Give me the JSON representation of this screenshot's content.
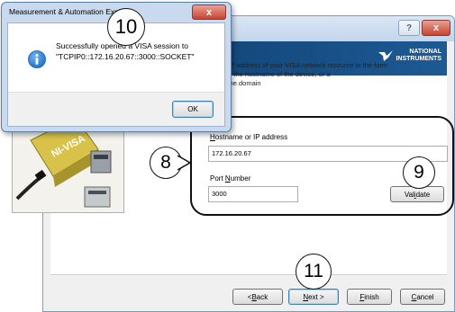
{
  "wizard": {
    "help_label": "?",
    "close_label": "x",
    "logo_line1": "NATIONAL",
    "logo_line2": "INSTRUMENTS",
    "instructions": [
      "Enter the TCP/IP address of your VISA network resource in the form",
      "xxx.xxx.xxx.xxx, the hostname of the device, or a",
      "hostname@some.domain"
    ],
    "hostname_label_accel": "H",
    "hostname_label_rest": "ostname or IP address",
    "hostname_value": "172.16.20.67",
    "port_label_pre": "Port ",
    "port_label_accel": "N",
    "port_label_rest": "umber",
    "port_value": "3000",
    "validate_pre": "Val",
    "validate_accel": "i",
    "validate_rest": "date",
    "back_pre": "< ",
    "back_accel": "B",
    "back_rest": "ack",
    "next_accel": "N",
    "next_rest": "ext >",
    "finish_accel": "F",
    "finish_rest": "inish",
    "cancel_accel": "C",
    "cancel_rest": "ancel"
  },
  "msgbox": {
    "title": "Measurement & Automation Explorer",
    "close_label": "x",
    "message_line1": "Successfully opened a VISA session to",
    "message_line2": "\"TCPIP0::172.16.20.67::3000::SOCKET\"",
    "ok_label": "OK",
    "icon": "info-icon"
  },
  "callouts": {
    "step_8": "8",
    "step_9": "9",
    "step_10": "10",
    "step_11": "11"
  },
  "colors": {
    "banner": "#0b3a6a",
    "info_icon": "#1f6fc5",
    "close_button": "#c8432f"
  }
}
